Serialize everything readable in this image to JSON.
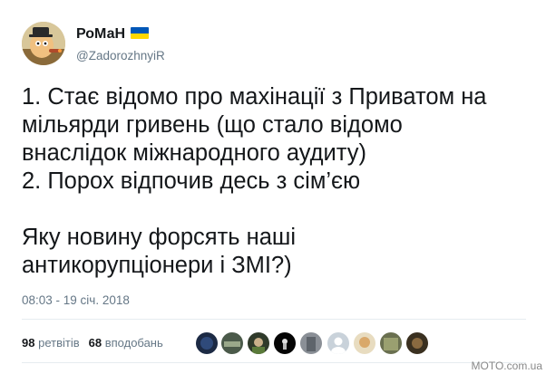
{
  "user": {
    "display_name": "РоМаН",
    "handle": "@ZadorozhnyiR",
    "flag_icon": "ukraine-flag-icon"
  },
  "tweet": {
    "lines": [
      "1. Стає відомо про махінації з Приватом на",
      "мільярди гривень (що стало відомо",
      "внаслідок міжнародного аудиту)",
      "2. Порох відпочив десь з сім’єю",
      "",
      "Яку новину форсять наші",
      "антикорупціонери і ЗМІ?)"
    ],
    "timestamp": "08:03 - 19 січ. 2018"
  },
  "stats": {
    "retweets_count": "98",
    "retweets_label": "ретвітів",
    "likes_count": "68",
    "likes_label": "вподобань"
  },
  "watermark": "MOTO.com.ua",
  "colors": {
    "text": "#14171a",
    "secondary": "#657786",
    "divider": "#e6ecf0",
    "flag_blue": "#0057b7",
    "flag_yellow": "#ffd700"
  }
}
